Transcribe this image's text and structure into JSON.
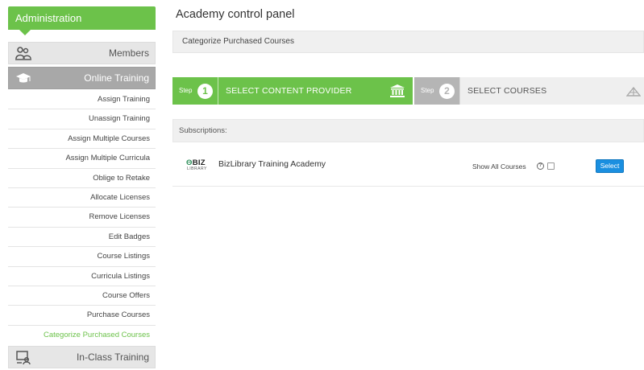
{
  "sidebar": {
    "header": "Administration",
    "sections": [
      {
        "label": "Members",
        "icon": "members-icon"
      },
      {
        "label": "Online Training",
        "icon": "graduation-cap-icon"
      },
      {
        "label": "In-Class Training",
        "icon": "classroom-icon"
      }
    ],
    "items": [
      "Assign Training",
      "Unassign Training",
      "Assign Multiple Courses",
      "Assign Multiple Curricula",
      "Oblige to Retake",
      "Allocate Licenses",
      "Remove Licenses",
      "Edit Badges",
      "Course Listings",
      "Curricula Listings",
      "Course Offers",
      "Purchase Courses",
      "Categorize Purchased Courses"
    ]
  },
  "main": {
    "title": "Academy control panel",
    "subheader": "Categorize Purchased Courses",
    "steps": [
      {
        "prefix": "Step",
        "number": "1",
        "label": "SELECT CONTENT PROVIDER",
        "icon": "institution-icon"
      },
      {
        "prefix": "Step",
        "number": "2",
        "label": "SELECT COURSES",
        "icon": "books-icon"
      }
    ],
    "subscriptions_label": "Subscriptions:",
    "subscription": {
      "logo_top_prefix": "Θ",
      "logo_top": "BIZ",
      "logo_bottom": "LIBRARY",
      "name": "BizLibrary Training Academy",
      "show_all_label": "Show All Courses",
      "help_symbol": "?",
      "select_label": "Select"
    }
  },
  "colors": {
    "accent_green": "#6cc24a",
    "button_blue": "#1a8fe0",
    "active_section_gray": "#a8a8a8"
  }
}
